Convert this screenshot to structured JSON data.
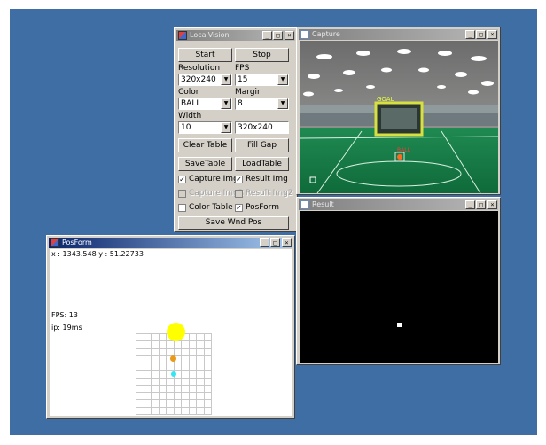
{
  "colors": {
    "desktop": "#3e6ea3",
    "ball_yellow": "#ffff00",
    "ball_orange": "#e89a18",
    "ball_cyan": "#33e6f2",
    "grid": "#c8c8c8"
  },
  "localvision": {
    "title": "LocalVision",
    "start_label": "Start",
    "stop_label": "Stop",
    "resolution_label": "Resolution",
    "resolution_value": "320x240",
    "fps_label": "FPS",
    "fps_value": "15",
    "color_label": "Color",
    "color_value": "BALL",
    "margin_label": "Margin",
    "margin_value": "8",
    "width_label": "Width",
    "width_value": "10",
    "size_text": "320x240",
    "clear_table_label": "Clear Table",
    "fill_gap_label": "Fill Gap",
    "save_table_label": "SaveTable",
    "load_table_label": "LoadTable",
    "capture_img_label": "Capture Img",
    "result_img_label": "Result Img",
    "capture_img2_label": "Capture Img2",
    "result_img2_label": "Result Img2",
    "color_table_label": "Color Table",
    "posform_label": "PosForm",
    "save_wnd_pos_label": "Save Wnd Pos"
  },
  "capture": {
    "title": "Capture",
    "goal_label": "GOAL",
    "ball_label": "BALL"
  },
  "result": {
    "title": "Result"
  },
  "posform": {
    "title": "PosForm",
    "coords": "x : 1343.548 y : 51.22733",
    "fps": "FPS: 13",
    "ip": "ip: 19ms"
  },
  "titlebar_buttons": {
    "minimize": "_",
    "maximize": "□",
    "close": "×"
  }
}
